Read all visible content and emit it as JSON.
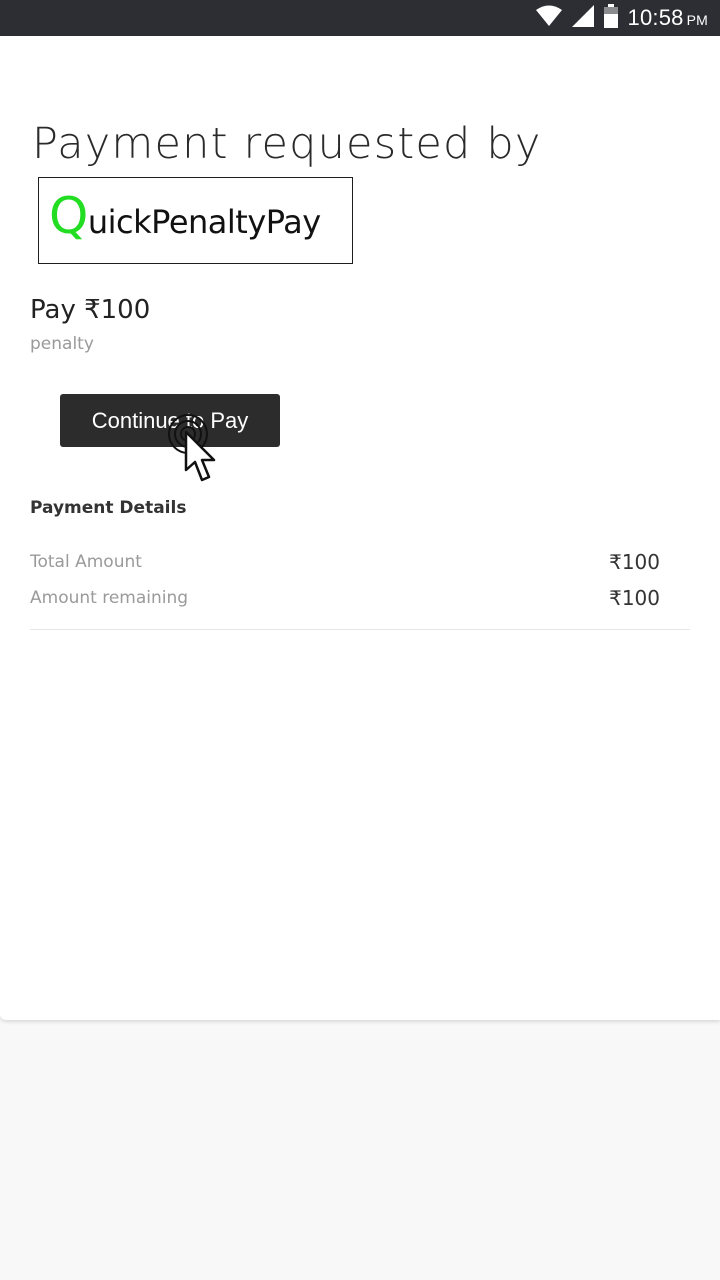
{
  "status_bar": {
    "time": "10:58",
    "ampm": "PM",
    "icons": [
      "wifi-icon",
      "cell-signal-icon",
      "battery-icon"
    ]
  },
  "payment": {
    "heading": "Payment requested by",
    "merchant_logo": {
      "initial": "Q",
      "rest": "uickPenaltyPay",
      "initial_color": "#22dd22"
    },
    "amount_label": "Pay ₹100",
    "purpose": "penalty",
    "continue_button": "Continue to Pay"
  },
  "details": {
    "title": "Payment Details",
    "rows": [
      {
        "label": "Total Amount",
        "value": "₹100"
      },
      {
        "label": "Amount remaining",
        "value": "₹100"
      }
    ]
  },
  "colors": {
    "status_bar": "#2d2e33",
    "button": "#2c2c2c",
    "page_background": "#f8f8f8"
  }
}
